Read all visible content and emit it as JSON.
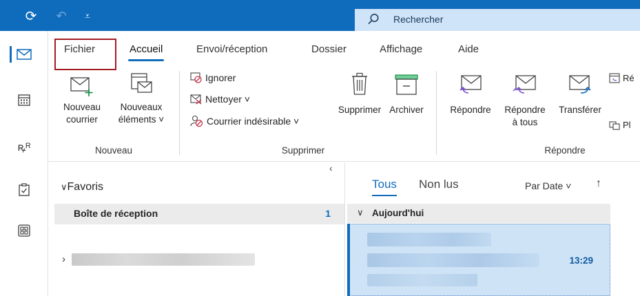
{
  "titlebar": {
    "search_placeholder": "Rechercher",
    "accent_color": "#0f6cbd"
  },
  "rail": {
    "items": [
      {
        "name": "mail",
        "icon": "mail-icon"
      },
      {
        "name": "calendar",
        "icon": "calendar-icon"
      },
      {
        "name": "people",
        "icon": "people-icon"
      },
      {
        "name": "tasks",
        "icon": "tasks-icon"
      },
      {
        "name": "apps",
        "icon": "apps-icon"
      }
    ]
  },
  "ribbon": {
    "tabs": [
      "Fichier",
      "Accueil",
      "Envoi/réception",
      "Dossier",
      "Affichage",
      "Aide"
    ],
    "active_tab": "Accueil",
    "groups": {
      "nouveau": {
        "label": "Nouveau",
        "new_mail": "Nouveau\ncourrier",
        "new_mail_l1": "Nouveau",
        "new_mail_l2": "courrier",
        "new_items_l1": "Nouveaux",
        "new_items_l2": "éléments ˅"
      },
      "supprimer": {
        "label": "Supprimer",
        "ignore": "Ignorer",
        "clean": "Nettoyer ˅",
        "junk": "Courrier indésirable ˅",
        "delete": "Supprimer",
        "archive": "Archiver"
      },
      "repondre": {
        "label": "Répondre",
        "reply": "Répondre",
        "reply_all_l1": "Répondre",
        "reply_all_l2": "à tous",
        "forward": "Transférer",
        "meeting_cut": "Ré",
        "more_cut": "Pl"
      }
    }
  },
  "folders": {
    "collapse": "‹",
    "favorites_label": "Favoris",
    "inbox_label": "Boîte de réception",
    "inbox_count": "1"
  },
  "messages": {
    "tab_all": "Tous",
    "tab_unread": "Non lus",
    "sort_label": "Par Date ˅",
    "sort_arrow": "↑",
    "group_today": "Aujourd'hui",
    "item_time": "13:29"
  }
}
